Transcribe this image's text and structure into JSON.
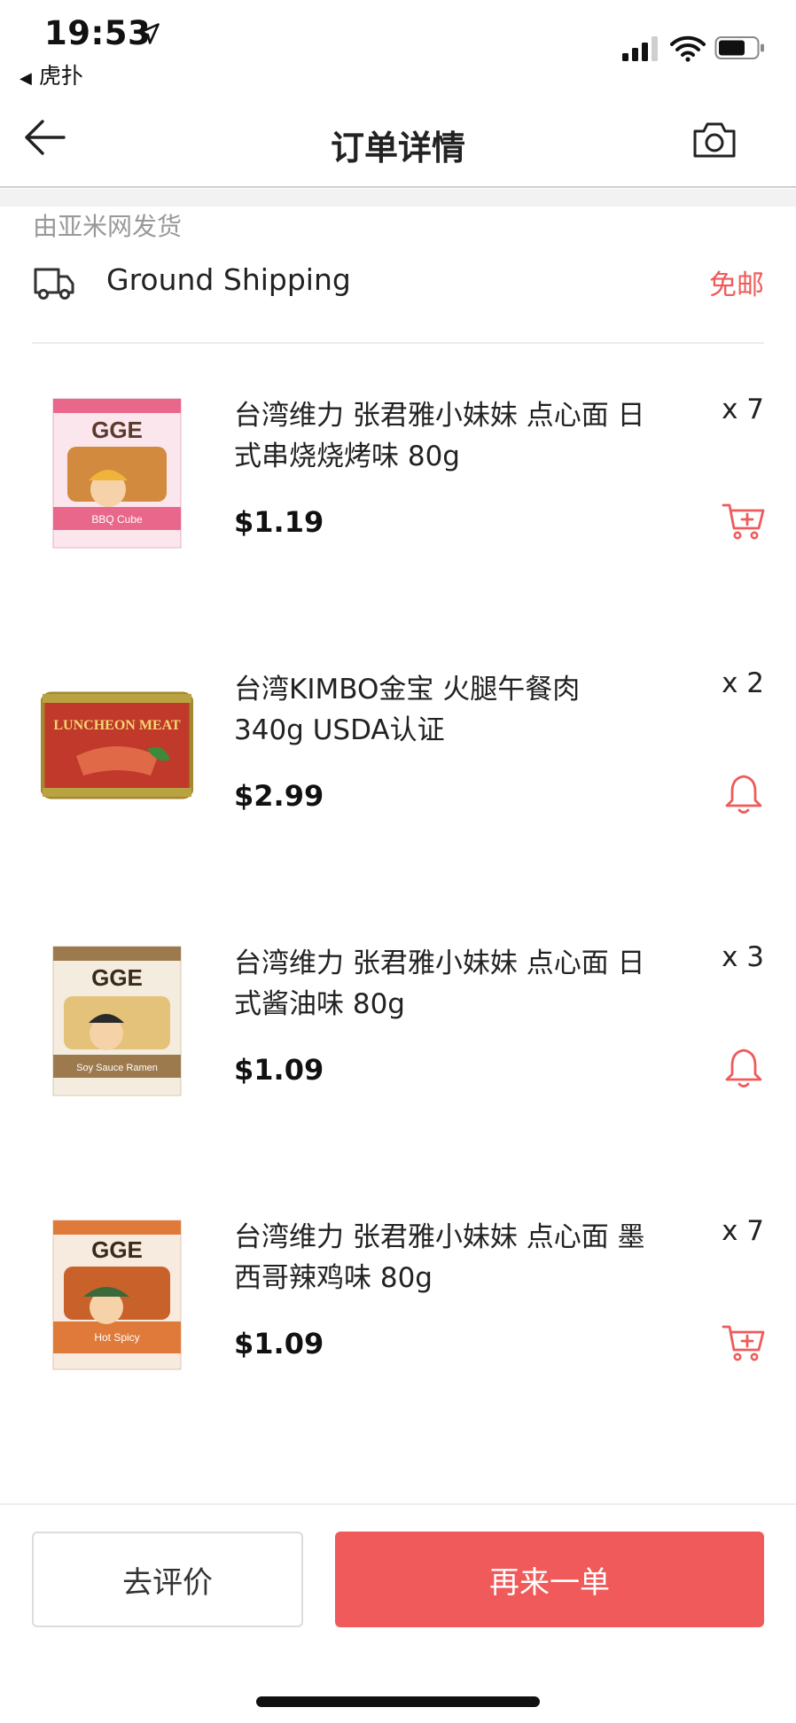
{
  "status_bar": {
    "time": "19:53",
    "back_app": "虎扑"
  },
  "nav": {
    "title": "订单详情"
  },
  "shipment": {
    "shipper": "由亚米网发货",
    "method": "Ground Shipping",
    "fee": "免邮"
  },
  "items": [
    {
      "name": "台湾维力 张君雅小妹妹 点心面 日式串烧烧烤味 80g",
      "price": "$1.19",
      "qty": "x 7",
      "action_icon": "add-to-cart-icon",
      "package_brand": "GGE",
      "package_flavor": "BBQ Cube",
      "package_color": "#e8678a"
    },
    {
      "name": "台湾KIMBO金宝 火腿午餐肉 340g USDA认证",
      "price": "$2.99",
      "qty": "x 2",
      "action_icon": "bell-icon",
      "package_brand": "LUNCHEON MEAT",
      "package_color": "#c0392b"
    },
    {
      "name": "台湾维力 张君雅小妹妹 点心面 日式酱油味 80g",
      "price": "$1.09",
      "qty": "x 3",
      "action_icon": "bell-icon",
      "package_brand": "GGE",
      "package_flavor": "Soy Sauce Ramen",
      "package_color": "#9c7a4e"
    },
    {
      "name": "台湾维力 张君雅小妹妹 点心面 墨西哥辣鸡味 80g",
      "price": "$1.09",
      "qty": "x 7",
      "action_icon": "add-to-cart-icon",
      "package_brand": "GGE",
      "package_flavor": "Hot Spicy",
      "package_color": "#e07a3a"
    }
  ],
  "footer": {
    "review_label": "去评价",
    "reorder_label": "再来一单"
  },
  "colors": {
    "accent": "#f05a5a",
    "fee_text": "#ef5b5b",
    "muted_text": "#999999"
  }
}
